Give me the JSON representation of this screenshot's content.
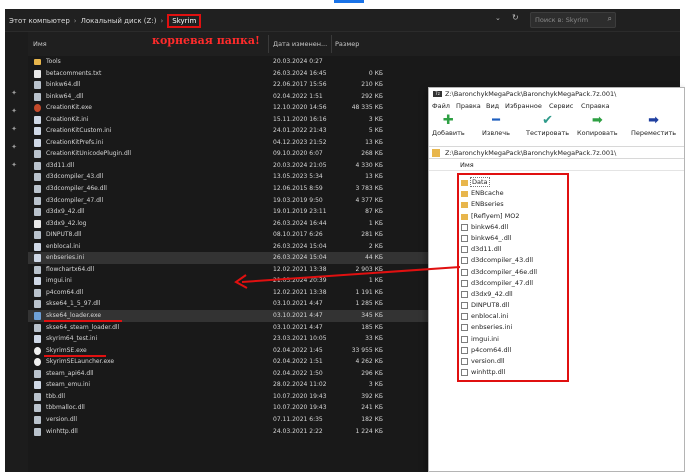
{
  "explorer": {
    "breadcrumb": [
      "Этот компьютер",
      "Локальный диск (Z:)",
      "Skyrim"
    ],
    "search_placeholder": "Поиск в: Skyrim",
    "columns": {
      "name": "Имя",
      "date": "Дата изменен...",
      "size": "Размер"
    },
    "root_annotation": "корневая папка!",
    "files": [
      {
        "name": "Tools",
        "date": "20.03.2024 0:27",
        "size": "",
        "icon": "folder-icon"
      },
      {
        "name": "betacomments.txt",
        "date": "26.03.2024 16:45",
        "size": "0 КБ",
        "icon": "text-file-icon"
      },
      {
        "name": "binkw64.dll",
        "date": "22.06.2017 15:56",
        "size": "210 КБ",
        "icon": "dll-file-icon"
      },
      {
        "name": "binkw64_.dll",
        "date": "02.04.2022 1:51",
        "size": "292 КБ",
        "icon": "dll-file-icon"
      },
      {
        "name": "CreationKit.exe",
        "date": "12.10.2020 14:56",
        "size": "48 335 КБ",
        "icon": "creationkit-exe-icon"
      },
      {
        "name": "CreationKit.ini",
        "date": "15.11.2020 16:16",
        "size": "3 КБ",
        "icon": "ini-file-icon"
      },
      {
        "name": "CreationKitCustom.ini",
        "date": "24.01.2022 21:43",
        "size": "5 КБ",
        "icon": "ini-file-icon"
      },
      {
        "name": "CreationKitPrefs.ini",
        "date": "04.12.2023 21:52",
        "size": "13 КБ",
        "icon": "ini-file-icon"
      },
      {
        "name": "CreationKitUnicodePlugin.dll",
        "date": "09.10.2020 6:07",
        "size": "268 КБ",
        "icon": "dll-file-icon"
      },
      {
        "name": "d3d11.dll",
        "date": "20.03.2024 21:05",
        "size": "4 330 КБ",
        "icon": "dll-file-icon"
      },
      {
        "name": "d3dcompiler_43.dll",
        "date": "13.05.2023 5:34",
        "size": "13 КБ",
        "icon": "dll-file-icon"
      },
      {
        "name": "d3dcompiler_46e.dll",
        "date": "12.06.2015 8:59",
        "size": "3 783 КБ",
        "icon": "dll-file-icon"
      },
      {
        "name": "d3dcompiler_47.dll",
        "date": "19.03.2019 9:50",
        "size": "4 377 КБ",
        "icon": "dll-file-icon"
      },
      {
        "name": "d3dx9_42.dll",
        "date": "19.01.2019 23:11",
        "size": "87 КБ",
        "icon": "dll-file-icon"
      },
      {
        "name": "d3dx9_42.log",
        "date": "26.03.2024 16:44",
        "size": "1 КБ",
        "icon": "text-file-icon"
      },
      {
        "name": "DINPUT8.dll",
        "date": "08.10.2017 6:26",
        "size": "281 КБ",
        "icon": "dll-file-icon"
      },
      {
        "name": "enblocal.ini",
        "date": "26.03.2024 15:04",
        "size": "2 КБ",
        "icon": "ini-file-icon"
      },
      {
        "name": "enbseries.ini",
        "date": "26.03.2024 15:04",
        "size": "44 КБ",
        "icon": "ini-file-icon"
      },
      {
        "name": "flowchartx64.dll",
        "date": "12.02.2021 13:38",
        "size": "2 903 КБ",
        "icon": "dll-file-icon"
      },
      {
        "name": "imgui.ini",
        "date": "21.03.2024 20:39",
        "size": "1 КБ",
        "icon": "ini-file-icon"
      },
      {
        "name": "p4com64.dll",
        "date": "12.02.2021 13:38",
        "size": "1 191 КБ",
        "icon": "dll-file-icon"
      },
      {
        "name": "skse64_1_5_97.dll",
        "date": "03.10.2021 4:47",
        "size": "1 285 КБ",
        "icon": "dll-file-icon"
      },
      {
        "name": "skse64_loader.exe",
        "date": "03.10.2021 4:47",
        "size": "345 КБ",
        "icon": "exe-file-icon"
      },
      {
        "name": "skse64_steam_loader.dll",
        "date": "03.10.2021 4:47",
        "size": "185 КБ",
        "icon": "dll-file-icon"
      },
      {
        "name": "skyrim64_test.ini",
        "date": "23.03.2021 10:05",
        "size": "33 КБ",
        "icon": "ini-file-icon"
      },
      {
        "name": "SkyrimSE.exe",
        "date": "02.04.2022 1:45",
        "size": "33 955 КБ",
        "icon": "skyrim-exe-icon"
      },
      {
        "name": "SkyrimSELauncher.exe",
        "date": "02.04.2022 1:51",
        "size": "4 262 КБ",
        "icon": "skyrim-exe-icon"
      },
      {
        "name": "steam_api64.dll",
        "date": "02.04.2022 1:50",
        "size": "296 КБ",
        "icon": "dll-file-icon"
      },
      {
        "name": "steam_emu.ini",
        "date": "28.02.2024 11:02",
        "size": "3 КБ",
        "icon": "ini-file-icon"
      },
      {
        "name": "tbb.dll",
        "date": "10.07.2020 19:43",
        "size": "392 КБ",
        "icon": "dll-file-icon"
      },
      {
        "name": "tbbmalloc.dll",
        "date": "10.07.2020 19:43",
        "size": "241 КБ",
        "icon": "dll-file-icon"
      },
      {
        "name": "version.dll",
        "date": "07.11.2021 6:35",
        "size": "182 КБ",
        "icon": "dll-file-icon"
      },
      {
        "name": "winhttp.dll",
        "date": "24.03.2021 2:22",
        "size": "1 224 КБ",
        "icon": "dll-file-icon"
      }
    ]
  },
  "sevenzip": {
    "title": "Z:\\BaronchykMegaPack\\BaronchykMegaPack.7z.001\\",
    "menu": [
      "Файл",
      "Правка",
      "Вид",
      "Избранное",
      "Сервис",
      "Справка"
    ],
    "toolbar": [
      {
        "label": "Добавить",
        "icon": "add-icon",
        "color": "#2ea043"
      },
      {
        "label": "Извлечь",
        "icon": "extract-icon",
        "color": "#1f5fbf"
      },
      {
        "label": "Тестировать",
        "icon": "test-icon",
        "color": "#2e9a8a"
      },
      {
        "label": "Копировать",
        "icon": "copy-icon",
        "color": "#2ea043"
      },
      {
        "label": "Переместить",
        "icon": "move-icon",
        "color": "#1f3fa0"
      }
    ],
    "path": "Z:\\BaronchykMegaPack\\BaronchykMegaPack.7z.001\\",
    "column_name": "Имя",
    "items": [
      {
        "name": "Data",
        "type": "folder"
      },
      {
        "name": "ENBcache",
        "type": "folder"
      },
      {
        "name": "ENBseries",
        "type": "folder"
      },
      {
        "name": "[Reflyem] MO2",
        "type": "folder"
      },
      {
        "name": "binkw64.dll",
        "type": "file"
      },
      {
        "name": "binkw64_.dll",
        "type": "file"
      },
      {
        "name": "d3d11.dll",
        "type": "file"
      },
      {
        "name": "d3dcompiler_43.dll",
        "type": "file"
      },
      {
        "name": "d3dcompiler_46e.dll",
        "type": "file"
      },
      {
        "name": "d3dcompiler_47.dll",
        "type": "file"
      },
      {
        "name": "d3dx9_42.dll",
        "type": "file"
      },
      {
        "name": "DINPUT8.dll",
        "type": "file"
      },
      {
        "name": "enblocal.ini",
        "type": "file"
      },
      {
        "name": "enbseries.ini",
        "type": "file"
      },
      {
        "name": "imgui.ini",
        "type": "file"
      },
      {
        "name": "p4com64.dll",
        "type": "file"
      },
      {
        "name": "version.dll",
        "type": "file"
      },
      {
        "name": "winhttp.dll",
        "type": "file"
      }
    ]
  },
  "colors": {
    "annotation_red": "#e01010",
    "explorer_bg": "#191919",
    "selected_row": "#333333"
  }
}
